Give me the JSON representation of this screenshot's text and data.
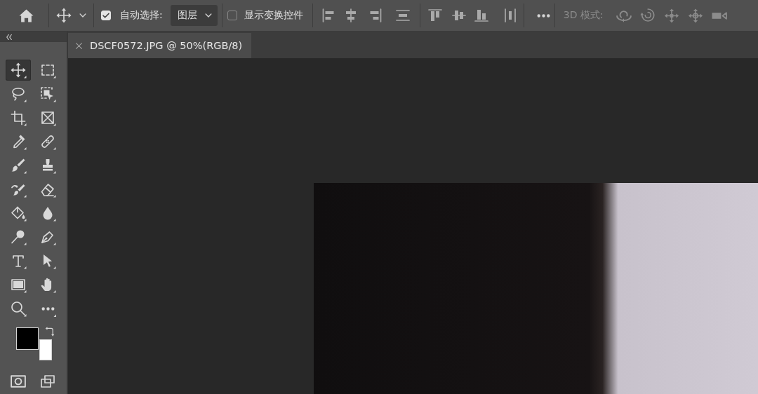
{
  "options_bar": {
    "auto_select": {
      "label": "自动选择:",
      "checked": true
    },
    "auto_select_target": {
      "value": "图层"
    },
    "show_transform_controls": {
      "label": "显示变换控件",
      "checked": false
    },
    "mode_3d": {
      "label": "3D 模式:",
      "disabled": true
    }
  },
  "document_tabs": [
    {
      "title": "DSCF0572.JPG @ 50%(RGB/8)",
      "selected": true
    }
  ],
  "toolbar": {
    "tools": [
      {
        "selected": true
      },
      {
        "selected": false
      },
      {
        "selected": false
      },
      {
        "selected": false
      },
      {
        "selected": false
      },
      {
        "selected": false
      },
      {
        "selected": false
      },
      {
        "selected": false
      },
      {
        "selected": false
      },
      {
        "selected": false
      },
      {
        "selected": false
      },
      {
        "selected": false
      },
      {
        "selected": false
      },
      {
        "selected": false
      },
      {
        "selected": false
      },
      {
        "selected": false
      },
      {
        "selected": false
      },
      {
        "selected": false
      },
      {
        "selected": false
      },
      {
        "selected": false
      },
      {
        "selected": false
      },
      {
        "selected": false
      }
    ],
    "color_swatches": [
      {
        "kind": "background",
        "color": "#ffffff"
      },
      {
        "kind": "foreground",
        "color": "#000000"
      }
    ]
  }
}
